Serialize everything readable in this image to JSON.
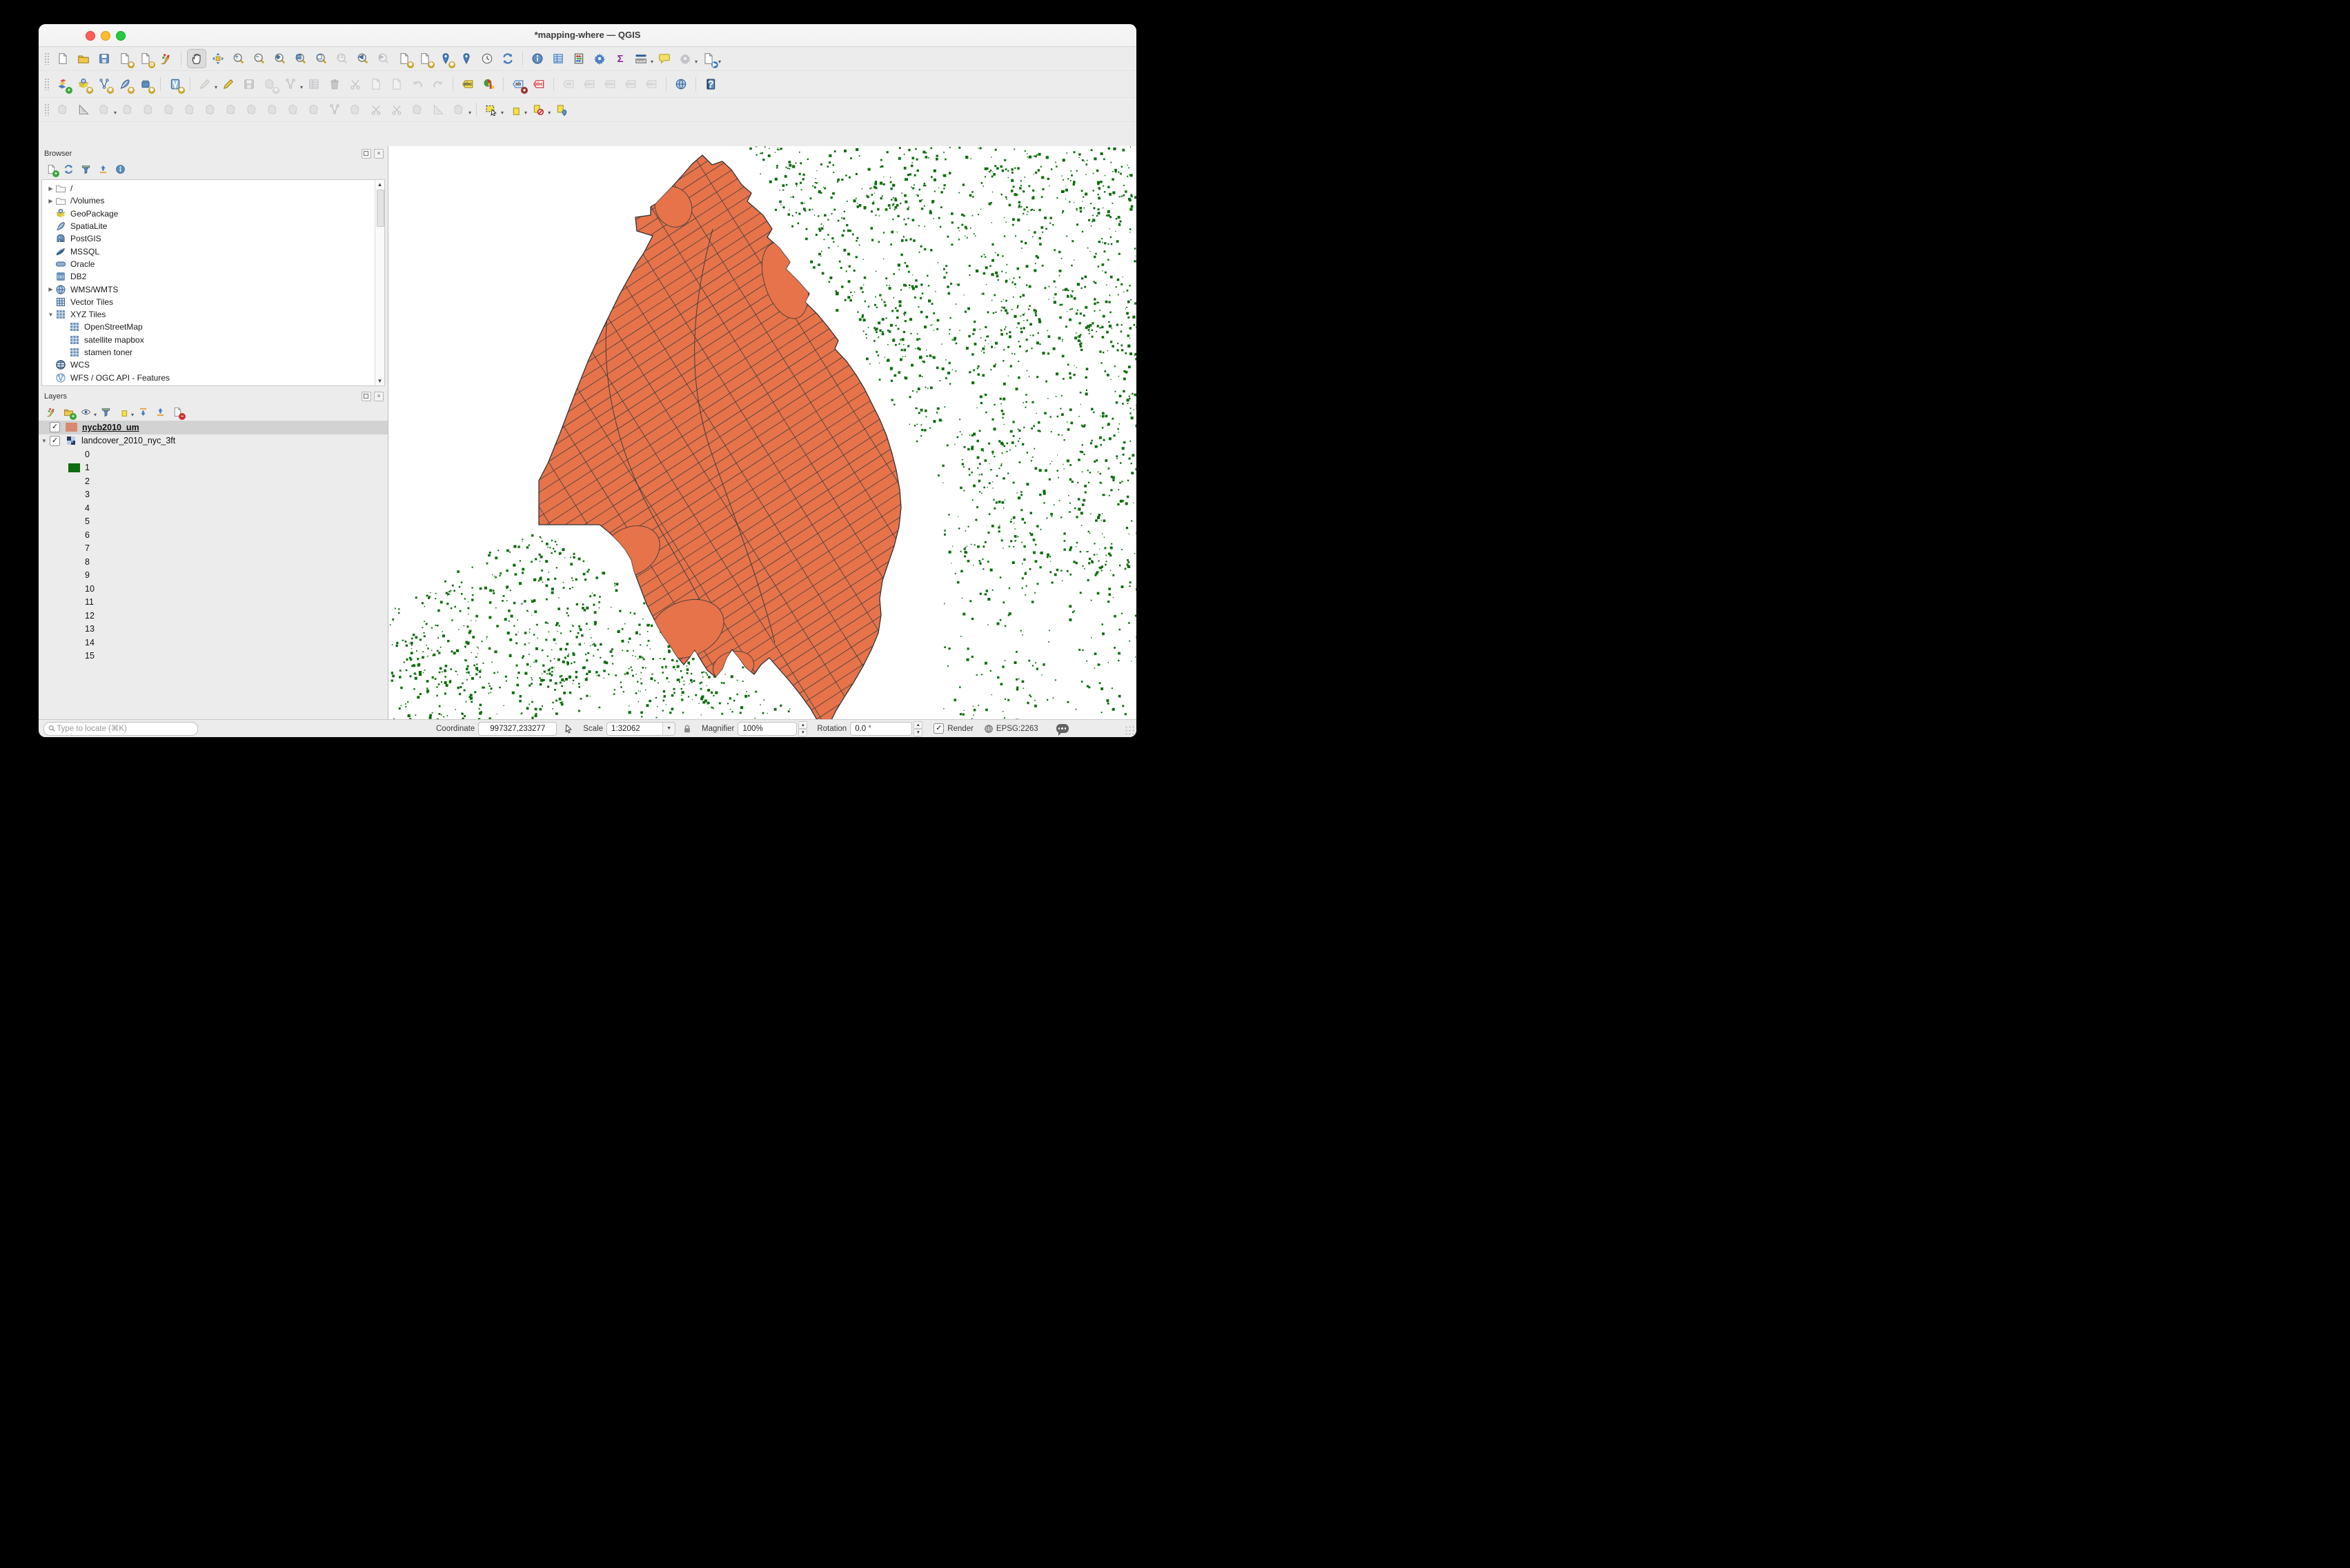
{
  "window": {
    "title": "*mapping-where — QGIS"
  },
  "toolbars": {
    "row1": [
      {
        "n": "new-project",
        "s": "sheet"
      },
      {
        "n": "open-project",
        "s": "folder"
      },
      {
        "n": "save-project",
        "s": "floppy"
      },
      {
        "n": "new-print-layout",
        "s": "sheet",
        "badge": "✱",
        "bc": "#c9a227"
      },
      {
        "n": "show-layout-manager",
        "s": "sheet",
        "badge": "⚙",
        "bc": "#c9a227"
      },
      {
        "n": "style-manager",
        "s": "brush"
      },
      {
        "sep": true
      },
      {
        "n": "pan-map",
        "s": "hand",
        "active": true
      },
      {
        "n": "pan-to-selection",
        "s": "movecross"
      },
      {
        "n": "zoom-in",
        "s": "mag",
        "ov": "+"
      },
      {
        "n": "zoom-out",
        "s": "mag",
        "ov": "−"
      },
      {
        "n": "zoom-full",
        "s": "mag",
        "ov": "◈"
      },
      {
        "n": "zoom-to-layer",
        "s": "mag",
        "ov": "▤"
      },
      {
        "n": "zoom-to-selection",
        "s": "mag",
        "ov": "▢"
      },
      {
        "n": "zoom-native",
        "s": "mag",
        "ov": "1:1",
        "tiny": true,
        "e": false
      },
      {
        "n": "zoom-last",
        "s": "mag",
        "ov": "◀"
      },
      {
        "n": "zoom-next",
        "s": "mag",
        "ov": "▶",
        "e": false
      },
      {
        "n": "new-map-view",
        "s": "sheet",
        "badge": "✱",
        "bc": "#c9a227"
      },
      {
        "n": "new-3d-map-view",
        "s": "sheet",
        "badge": "✱",
        "bc": "#c9a227"
      },
      {
        "n": "new-spatial-bookmark",
        "s": "pin",
        "badge": "✱",
        "bc": "#c9a227"
      },
      {
        "n": "show-spatial-bookmarks",
        "s": "pin"
      },
      {
        "n": "temporal-controller",
        "s": "clock"
      },
      {
        "n": "refresh-map",
        "s": "refresh"
      },
      {
        "sep": true
      },
      {
        "n": "identify-features",
        "s": "info"
      },
      {
        "n": "open-attribute-table",
        "s": "table"
      },
      {
        "n": "field-calculator",
        "s": "abacus"
      },
      {
        "n": "processing-toolbox",
        "s": "gear"
      },
      {
        "n": "statistical-summary",
        "s": "txt",
        "ov": "Σ",
        "oc": "#8e2a9e"
      },
      {
        "n": "measure-line",
        "s": "ruler",
        "dd": true
      },
      {
        "n": "map-tips",
        "s": "bubble"
      },
      {
        "n": "run-feature-action",
        "s": "gear",
        "e": false,
        "dd": true
      },
      {
        "n": "default-feature-action",
        "s": "sheet",
        "badge": "▶",
        "bc": "#4a7fc1",
        "dd": true
      }
    ],
    "row2": [
      {
        "n": "open-data-source-manager",
        "s": "layers",
        "badge": "+",
        "bc": "#3aa33a"
      },
      {
        "n": "add-vector-layer",
        "s": "geopackage",
        "badge": "✱",
        "bc": "#c9a227"
      },
      {
        "n": "add-delimited-text-layer",
        "s": "vnodes",
        "badge": "✱",
        "bc": "#c9a227"
      },
      {
        "n": "add-spatialite-layer",
        "s": "feather",
        "badge": "✱",
        "bc": "#c9a227"
      },
      {
        "n": "add-postgis-layer",
        "s": "chip",
        "badge": "✱",
        "bc": "#c9a227"
      },
      {
        "sep": true
      },
      {
        "n": "add-virtual-layer",
        "s": "vlayer",
        "badge": "✱",
        "bc": "#c9a227"
      },
      {
        "sep": true
      },
      {
        "n": "current-edits",
        "s": "pencil",
        "e": false,
        "dd": true
      },
      {
        "n": "toggle-editing",
        "s": "pencil"
      },
      {
        "n": "save-layer-edits",
        "s": "floppy",
        "e": false
      },
      {
        "n": "add-feature",
        "s": "blob",
        "e": false,
        "badge": "✱",
        "bc": "#c9a227"
      },
      {
        "n": "vertex-tool",
        "s": "vnodes",
        "e": false,
        "dd": true
      },
      {
        "n": "modify-attributes-of-selected",
        "s": "table",
        "e": false
      },
      {
        "n": "delete-selected",
        "s": "trash",
        "e": false
      },
      {
        "n": "cut-features",
        "s": "scissors",
        "e": false
      },
      {
        "n": "copy-features",
        "s": "sheet",
        "e": false
      },
      {
        "n": "paste-features",
        "s": "sheet",
        "e": false
      },
      {
        "n": "undo",
        "s": "undo",
        "e": false
      },
      {
        "n": "redo",
        "s": "redo",
        "e": false
      },
      {
        "sep": true
      },
      {
        "n": "layer-labeling",
        "s": "tag",
        "tf": "#f5e34f",
        "ts": "#a08a1f",
        "ov": "abc",
        "oc": "#333"
      },
      {
        "n": "layer-diagram",
        "s": "pie"
      },
      {
        "sep": true
      },
      {
        "n": "layer-labeling-single",
        "s": "tag",
        "tf": "#dce9f7",
        "ts": "#4a7fc1",
        "ov": "ab",
        "oc": "#333",
        "badge": "●",
        "bc": "#a03030"
      },
      {
        "n": "layer-labeling-rule-based",
        "s": "tag",
        "tf": "#ffffff",
        "ts": "#cc2222",
        "ov": "abc",
        "oc": "#cc2222"
      },
      {
        "sep": true
      },
      {
        "n": "pin-unpin-labels",
        "s": "tag",
        "tf": "#eeeeee",
        "ts": "#999999",
        "ov": "ab",
        "oc": "#888",
        "e": false
      },
      {
        "n": "show-hidden-labels",
        "s": "tag",
        "tf": "#eeeeee",
        "ts": "#999999",
        "ov": "abc",
        "oc": "#888",
        "e": false
      },
      {
        "n": "move-label",
        "s": "tag",
        "tf": "#eeeeee",
        "ts": "#999999",
        "ov": "abc",
        "oc": "#888",
        "e": false
      },
      {
        "n": "rotate-label",
        "s": "tag",
        "tf": "#eeeeee",
        "ts": "#999999",
        "ov": "abc",
        "oc": "#888",
        "e": false
      },
      {
        "n": "change-label-properties",
        "s": "tag",
        "tf": "#eeeeee",
        "ts": "#999999",
        "ov": "abc",
        "oc": "#888",
        "e": false
      },
      {
        "sep": true
      },
      {
        "n": "metasearch",
        "s": "globe"
      },
      {
        "sep": true
      },
      {
        "n": "help",
        "s": "help",
        "ov": "?",
        "oc": "#ffffff"
      }
    ],
    "row3": [
      {
        "n": "enable-advanced-digitizing",
        "s": "blob",
        "e": false
      },
      {
        "n": "snapping-options",
        "s": "setsq"
      },
      {
        "n": "move-feature",
        "s": "blob",
        "e": false,
        "dd": true
      },
      {
        "n": "copy-move-feature",
        "s": "blob",
        "e": false
      },
      {
        "n": "rotate-feature",
        "s": "blob",
        "e": false
      },
      {
        "n": "simplify-feature",
        "s": "blob",
        "e": false
      },
      {
        "n": "add-ring",
        "s": "blob",
        "e": false
      },
      {
        "n": "add-part",
        "s": "blob",
        "e": false
      },
      {
        "n": "fill-ring",
        "s": "blob",
        "e": false
      },
      {
        "n": "delete-ring",
        "s": "blob",
        "e": false
      },
      {
        "n": "delete-part",
        "s": "blob",
        "e": false
      },
      {
        "n": "reshape-features",
        "s": "blob",
        "e": false
      },
      {
        "n": "offset-curve",
        "s": "blob",
        "e": false
      },
      {
        "n": "split-features",
        "s": "vnodes",
        "e": false
      },
      {
        "n": "split-parts",
        "s": "blob",
        "e": false
      },
      {
        "n": "merge-selected-features",
        "s": "scissors",
        "e": false
      },
      {
        "n": "merge-attributes",
        "s": "scissors",
        "e": false
      },
      {
        "n": "rotate-point-symbols",
        "s": "blob",
        "e": false
      },
      {
        "n": "offset-point-symbols",
        "s": "setsq",
        "e": false
      },
      {
        "n": "trim-extend-feature",
        "s": "blob",
        "e": false,
        "dd": true
      },
      {
        "sep": true
      },
      {
        "n": "select-features-by-area",
        "s": "selrect",
        "dd": true
      },
      {
        "n": "select-by-expression",
        "s": "epsilon",
        "dd": true
      },
      {
        "n": "deselect-features",
        "s": "nosign",
        "dd": true
      },
      {
        "n": "select-by-form",
        "s": "pinloc"
      }
    ]
  },
  "browser": {
    "title": "Browser",
    "tools": [
      {
        "n": "add-selected-layers",
        "s": "sheet",
        "badge": "+",
        "bc": "#3aa33a"
      },
      {
        "n": "refresh-browser",
        "s": "refresh"
      },
      {
        "n": "filter-browser",
        "s": "funnel"
      },
      {
        "n": "collapse-all",
        "s": "arrowup"
      },
      {
        "n": "properties-widget",
        "s": "info"
      }
    ],
    "items": [
      {
        "label": "/",
        "icon": "folder",
        "expander": "closed",
        "indent": 0
      },
      {
        "label": "/Volumes",
        "icon": "folder",
        "expander": "closed",
        "indent": 0
      },
      {
        "label": "GeoPackage",
        "icon": "geopackage",
        "indent": 0
      },
      {
        "label": "SpatiaLite",
        "icon": "feather",
        "indent": 0
      },
      {
        "label": "PostGIS",
        "icon": "postgis",
        "indent": 0
      },
      {
        "label": "MSSQL",
        "icon": "mssql",
        "indent": 0
      },
      {
        "label": "Oracle",
        "icon": "oracle",
        "indent": 0
      },
      {
        "label": "DB2",
        "icon": "db2",
        "indent": 0
      },
      {
        "label": "WMS/WMTS",
        "icon": "globe",
        "expander": "closed",
        "indent": 0
      },
      {
        "label": "Vector Tiles",
        "icon": "vectortiles",
        "indent": 0
      },
      {
        "label": "XYZ Tiles",
        "icon": "xyz",
        "expander": "open",
        "indent": 0
      },
      {
        "label": "OpenStreetMap",
        "icon": "xyz",
        "indent": 1
      },
      {
        "label": "satellite mapbox",
        "icon": "xyz",
        "indent": 1
      },
      {
        "label": "stamen toner",
        "icon": "xyz",
        "indent": 1
      },
      {
        "label": "WCS",
        "icon": "globe2",
        "indent": 0
      },
      {
        "label": "WFS / OGC API - Features",
        "icon": "wfs",
        "indent": 0
      }
    ]
  },
  "layers": {
    "title": "Layers",
    "tools": [
      {
        "n": "open-layer-styling",
        "s": "brush"
      },
      {
        "n": "add-group",
        "s": "folder",
        "badge": "+",
        "bc": "#3aa33a"
      },
      {
        "n": "manage-map-themes",
        "s": "eye",
        "dd": true
      },
      {
        "n": "filter-legend",
        "s": "funnel"
      },
      {
        "n": "filter-by-expression",
        "s": "epsilon",
        "dd": true
      },
      {
        "n": "expand-all",
        "s": "arrowdn"
      },
      {
        "n": "collapse-all",
        "s": "arrowup"
      },
      {
        "n": "remove-layer",
        "s": "sheet",
        "badge": "−",
        "bc": "#cc3333"
      }
    ],
    "items": [
      {
        "label": "nycb2010_um",
        "checked": true,
        "selected": true,
        "bold": true,
        "swatch": "#d8896f"
      },
      {
        "label": "landcover_2010_nyc_3ft",
        "checked": true,
        "expander": "open",
        "icon": "raster"
      }
    ],
    "legend": [
      {
        "label": "0"
      },
      {
        "label": "1",
        "swatch": "#0e6c0e"
      },
      {
        "label": "2"
      },
      {
        "label": "3"
      },
      {
        "label": "4"
      },
      {
        "label": "5"
      },
      {
        "label": "6"
      },
      {
        "label": "7"
      },
      {
        "label": "8"
      },
      {
        "label": "9"
      },
      {
        "label": "10"
      },
      {
        "label": "11"
      },
      {
        "label": "12"
      },
      {
        "label": "13"
      },
      {
        "label": "14"
      },
      {
        "label": "15"
      }
    ]
  },
  "map": {
    "background": "#ffffff",
    "fill": "#e6734a",
    "outline": "#2e3237",
    "grid_color": "#363a40",
    "green": "#0e6c0e",
    "speckle_seed": 7,
    "speckle_count": 17000,
    "street_angle": -33,
    "street_gap": 15,
    "avenue_angle": 58,
    "avenue_gap": 46,
    "polygon": [
      455,
      13,
      469,
      27,
      484,
      22,
      497,
      34,
      512,
      56,
      526,
      68,
      520,
      80,
      543,
      100,
      556,
      120,
      549,
      132,
      566,
      147,
      582,
      168,
      576,
      178,
      594,
      196,
      610,
      214,
      604,
      226,
      622,
      244,
      637,
      262,
      652,
      282,
      647,
      294,
      664,
      312,
      678,
      332,
      690,
      352,
      700,
      372,
      712,
      396,
      722,
      420,
      730,
      446,
      736,
      470,
      741,
      498,
      743,
      524,
      740,
      552,
      733,
      580,
      724,
      606,
      716,
      630,
      712,
      656,
      714,
      680,
      710,
      706,
      700,
      730,
      688,
      754,
      674,
      778,
      660,
      800,
      649,
      818,
      640,
      836,
      645,
      852,
      634,
      860,
      628,
      844,
      612,
      816,
      596,
      794,
      580,
      774,
      565,
      757,
      552,
      742,
      540,
      752,
      530,
      766,
      518,
      756,
      508,
      742,
      498,
      730,
      490,
      742,
      484,
      758,
      474,
      770,
      462,
      760,
      452,
      744,
      444,
      730,
      436,
      742,
      428,
      752,
      418,
      740,
      408,
      724,
      398,
      710,
      390,
      696,
      382,
      680,
      374,
      664,
      368,
      648,
      362,
      632,
      356,
      616,
      352,
      600,
      344,
      586,
      334,
      574,
      322,
      562,
      310,
      552,
      306,
      549,
      218,
      549,
      218,
      485,
      231,
      460,
      248,
      418,
      270,
      360,
      290,
      310,
      313,
      260,
      335,
      215,
      360,
      170,
      370,
      155,
      383,
      130,
      360,
      123,
      358,
      103,
      380,
      100,
      380,
      88,
      388,
      83,
      410,
      60,
      428,
      40,
      440,
      26
    ],
    "parks": [
      [
        575,
        195,
        30,
        57,
        -18
      ],
      [
        413,
        88,
        26,
        30,
        -25
      ],
      [
        350,
        588,
        46,
        34,
        -30
      ],
      [
        432,
        700,
        56,
        40,
        -22
      ],
      [
        500,
        755,
        30,
        22,
        -15
      ]
    ]
  },
  "statusbar": {
    "locate_placeholder": "Type to locate (⌘K)",
    "coordinate_label": "Coordinate",
    "coordinate_value": "997327,233277",
    "scale_label": "Scale",
    "scale_value": "1:32062",
    "magnifier_label": "Magnifier",
    "magnifier_value": "100%",
    "rotation_label": "Rotation",
    "rotation_value": "0.0 °",
    "render_label": "Render",
    "crs": "EPSG:2263"
  }
}
